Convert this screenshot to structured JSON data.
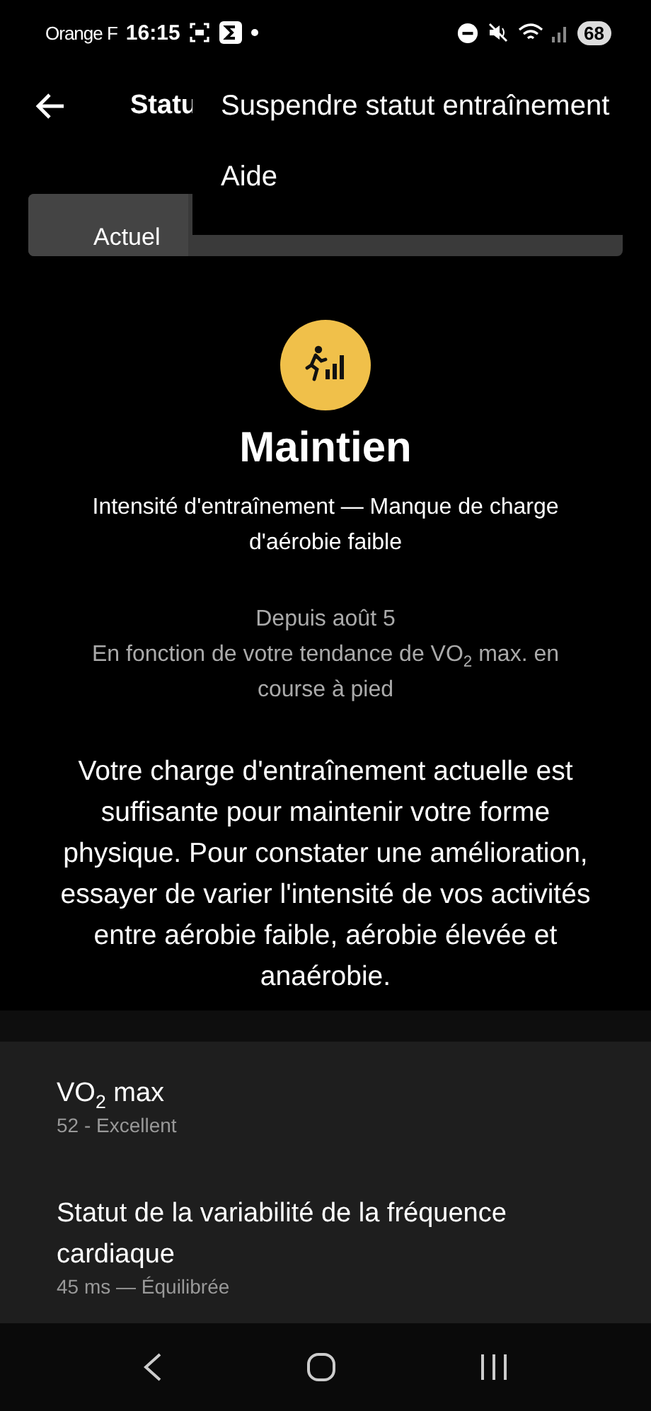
{
  "status_bar": {
    "carrier": "Orange F",
    "time": "16:15",
    "battery": "68"
  },
  "header": {
    "title": "Statu"
  },
  "tabs": [
    {
      "label": "Actuel",
      "selected": true
    }
  ],
  "menu": {
    "items": [
      "Suspendre statut entraînement",
      "Aide"
    ]
  },
  "status": {
    "title": "Maintien",
    "subtitle": "Intensité d'entraînement — Manque de charge d'aérobie faible",
    "since": "Depuis août 5",
    "basis": "En fonction de votre tendance de VO$_{2}$ max. en course à pied",
    "description": "Votre charge d'entraînement actuelle est suffisante pour maintenir votre forme physique. Pour constater une amélioration, essayer de varier l'intensité de vos activités entre aérobie faible, aérobie élevée et anaérobie."
  },
  "metrics": [
    {
      "title": "VO$_{2}$ max",
      "value": "52 - Excellent"
    },
    {
      "title": "Statut de la variabilité de la fréquence cardiaque",
      "value": "45 ms — Équilibrée"
    }
  ]
}
